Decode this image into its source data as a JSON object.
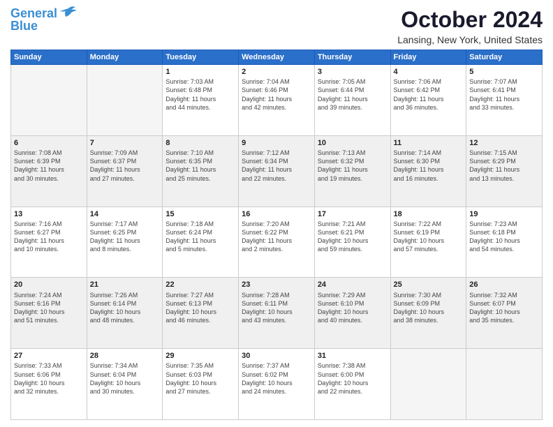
{
  "header": {
    "logo_line1": "General",
    "logo_line2": "Blue",
    "month_title": "October 2024",
    "location": "Lansing, New York, United States"
  },
  "weekdays": [
    "Sunday",
    "Monday",
    "Tuesday",
    "Wednesday",
    "Thursday",
    "Friday",
    "Saturday"
  ],
  "rows": [
    [
      {
        "day": "",
        "empty": true
      },
      {
        "day": "",
        "empty": true
      },
      {
        "day": "1",
        "info": "Sunrise: 7:03 AM\nSunset: 6:48 PM\nDaylight: 11 hours\nand 44 minutes."
      },
      {
        "day": "2",
        "info": "Sunrise: 7:04 AM\nSunset: 6:46 PM\nDaylight: 11 hours\nand 42 minutes."
      },
      {
        "day": "3",
        "info": "Sunrise: 7:05 AM\nSunset: 6:44 PM\nDaylight: 11 hours\nand 39 minutes."
      },
      {
        "day": "4",
        "info": "Sunrise: 7:06 AM\nSunset: 6:42 PM\nDaylight: 11 hours\nand 36 minutes."
      },
      {
        "day": "5",
        "info": "Sunrise: 7:07 AM\nSunset: 6:41 PM\nDaylight: 11 hours\nand 33 minutes."
      }
    ],
    [
      {
        "day": "6",
        "info": "Sunrise: 7:08 AM\nSunset: 6:39 PM\nDaylight: 11 hours\nand 30 minutes."
      },
      {
        "day": "7",
        "info": "Sunrise: 7:09 AM\nSunset: 6:37 PM\nDaylight: 11 hours\nand 27 minutes."
      },
      {
        "day": "8",
        "info": "Sunrise: 7:10 AM\nSunset: 6:35 PM\nDaylight: 11 hours\nand 25 minutes."
      },
      {
        "day": "9",
        "info": "Sunrise: 7:12 AM\nSunset: 6:34 PM\nDaylight: 11 hours\nand 22 minutes."
      },
      {
        "day": "10",
        "info": "Sunrise: 7:13 AM\nSunset: 6:32 PM\nDaylight: 11 hours\nand 19 minutes."
      },
      {
        "day": "11",
        "info": "Sunrise: 7:14 AM\nSunset: 6:30 PM\nDaylight: 11 hours\nand 16 minutes."
      },
      {
        "day": "12",
        "info": "Sunrise: 7:15 AM\nSunset: 6:29 PM\nDaylight: 11 hours\nand 13 minutes."
      }
    ],
    [
      {
        "day": "13",
        "info": "Sunrise: 7:16 AM\nSunset: 6:27 PM\nDaylight: 11 hours\nand 10 minutes."
      },
      {
        "day": "14",
        "info": "Sunrise: 7:17 AM\nSunset: 6:25 PM\nDaylight: 11 hours\nand 8 minutes."
      },
      {
        "day": "15",
        "info": "Sunrise: 7:18 AM\nSunset: 6:24 PM\nDaylight: 11 hours\nand 5 minutes."
      },
      {
        "day": "16",
        "info": "Sunrise: 7:20 AM\nSunset: 6:22 PM\nDaylight: 11 hours\nand 2 minutes."
      },
      {
        "day": "17",
        "info": "Sunrise: 7:21 AM\nSunset: 6:21 PM\nDaylight: 10 hours\nand 59 minutes."
      },
      {
        "day": "18",
        "info": "Sunrise: 7:22 AM\nSunset: 6:19 PM\nDaylight: 10 hours\nand 57 minutes."
      },
      {
        "day": "19",
        "info": "Sunrise: 7:23 AM\nSunset: 6:18 PM\nDaylight: 10 hours\nand 54 minutes."
      }
    ],
    [
      {
        "day": "20",
        "info": "Sunrise: 7:24 AM\nSunset: 6:16 PM\nDaylight: 10 hours\nand 51 minutes."
      },
      {
        "day": "21",
        "info": "Sunrise: 7:26 AM\nSunset: 6:14 PM\nDaylight: 10 hours\nand 48 minutes."
      },
      {
        "day": "22",
        "info": "Sunrise: 7:27 AM\nSunset: 6:13 PM\nDaylight: 10 hours\nand 46 minutes."
      },
      {
        "day": "23",
        "info": "Sunrise: 7:28 AM\nSunset: 6:11 PM\nDaylight: 10 hours\nand 43 minutes."
      },
      {
        "day": "24",
        "info": "Sunrise: 7:29 AM\nSunset: 6:10 PM\nDaylight: 10 hours\nand 40 minutes."
      },
      {
        "day": "25",
        "info": "Sunrise: 7:30 AM\nSunset: 6:09 PM\nDaylight: 10 hours\nand 38 minutes."
      },
      {
        "day": "26",
        "info": "Sunrise: 7:32 AM\nSunset: 6:07 PM\nDaylight: 10 hours\nand 35 minutes."
      }
    ],
    [
      {
        "day": "27",
        "info": "Sunrise: 7:33 AM\nSunset: 6:06 PM\nDaylight: 10 hours\nand 32 minutes."
      },
      {
        "day": "28",
        "info": "Sunrise: 7:34 AM\nSunset: 6:04 PM\nDaylight: 10 hours\nand 30 minutes."
      },
      {
        "day": "29",
        "info": "Sunrise: 7:35 AM\nSunset: 6:03 PM\nDaylight: 10 hours\nand 27 minutes."
      },
      {
        "day": "30",
        "info": "Sunrise: 7:37 AM\nSunset: 6:02 PM\nDaylight: 10 hours\nand 24 minutes."
      },
      {
        "day": "31",
        "info": "Sunrise: 7:38 AM\nSunset: 6:00 PM\nDaylight: 10 hours\nand 22 minutes."
      },
      {
        "day": "",
        "empty": true
      },
      {
        "day": "",
        "empty": true
      }
    ]
  ]
}
